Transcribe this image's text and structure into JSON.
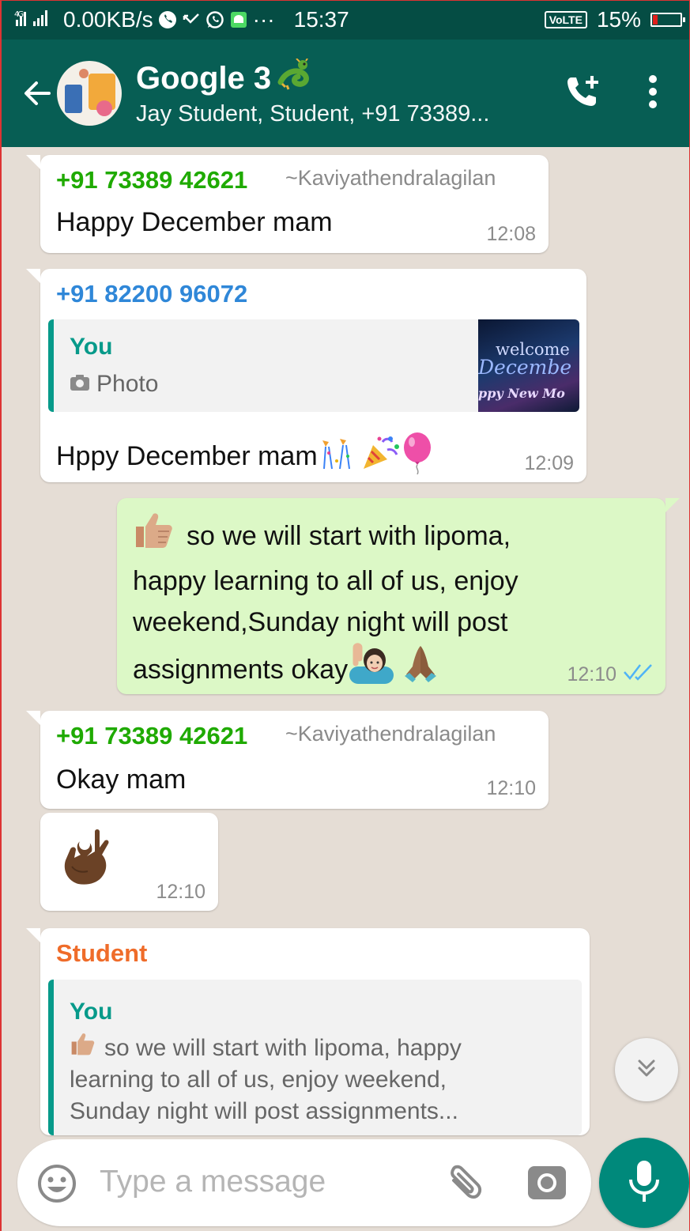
{
  "status_bar": {
    "network": "4G",
    "speed": "0.00KB/s",
    "time": "15:37",
    "volte": "VoLTE",
    "battery": "15%",
    "battery_level": 0.15,
    "icons": [
      "signal-icon",
      "viber-icon",
      "missed-call-icon",
      "whatsapp-icon",
      "android-icon",
      "more-dots-icon"
    ]
  },
  "header": {
    "title": "Google 3",
    "subtitle": "Jay Student, Student, +91 73389...",
    "accent": "#075e54",
    "icons": [
      "back-arrow-icon",
      "group-avatar",
      "dragon-emoji",
      "add-call-icon",
      "overflow-menu-icon"
    ]
  },
  "messages": [
    {
      "sender": "+91 73389 42621",
      "push_name": "~Kaviyathendralagilan",
      "text": "Happy December mam",
      "time": "12:08",
      "sender_color": "#1faa00"
    },
    {
      "sender": "+91 82200 96072",
      "quote_author": "You",
      "quote_type": "Photo",
      "quote_thumb_text": [
        "welcome",
        "Decembe",
        "ppy New Mo"
      ],
      "text": "Hppy December mam",
      "time": "12:09",
      "sender_color": "#2f87d8"
    },
    {
      "text_lines": [
        "so we will start with lipoma,",
        "happy learning to all of us, enjoy",
        "weekend,Sunday night will post",
        "assignments okay"
      ],
      "time": "12:10",
      "status": "read"
    },
    {
      "sender": "+91 73389 42621",
      "push_name": "~Kaviyathendralagilan",
      "text": "Okay mam",
      "time": "12:10"
    },
    {
      "emoji": "ok-hand",
      "time": "12:10"
    },
    {
      "sender": "Student",
      "quote_author": "You",
      "quote_lines": [
        "so we will start with lipoma, happy",
        "learning to all of us, enjoy weekend,",
        "Sunday night will post assignments..."
      ],
      "sender_color": "#ef6c2a"
    }
  ],
  "composer": {
    "placeholder": "Type a message"
  }
}
